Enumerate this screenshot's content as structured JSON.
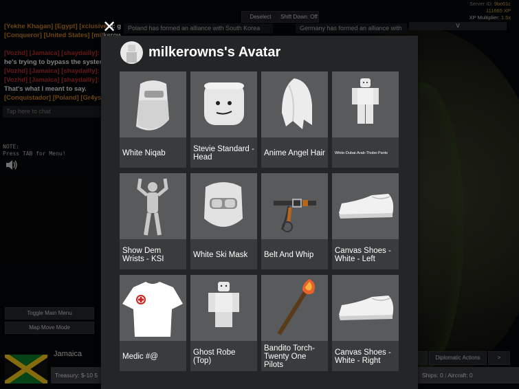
{
  "hud": {
    "deselect": "Deselect",
    "shift_down": "Shift Down: Off",
    "server_label": "Server ID:",
    "server_id": "9bc61c",
    "xp": "111665 XP",
    "xp_mult_label": "XP Multiplier:",
    "xp_mult_value": "1.5x"
  },
  "notifications": [
    "Poland has formed an alliance with South Korea",
    "Germany has formed an alliance with"
  ],
  "search_text": "V",
  "chat": {
    "lines": [
      {
        "parts": [
          {
            "text": "[Yekhe Khagan] [Egypt] [xclusive",
            "color": "org"
          },
          {
            "text": "k]:  grow",
            "color": "txt"
          }
        ]
      },
      {
        "parts": [
          {
            "text": "[Conqueror] [United States] [mil",
            "color": "org"
          },
          {
            "text": "kerowns]:",
            "color": "txt"
          }
        ]
      },
      {
        "parts": [
          {
            "text": "",
            "color": "txt"
          }
        ]
      },
      {
        "parts": [
          {
            "text": "[Vozhd] [Jamaica] [shaydailly]:",
            "color": "red"
          }
        ]
      },
      {
        "parts": [
          {
            "text": "he's trying to bypass the system",
            "color": "txt"
          }
        ]
      },
      {
        "parts": [
          {
            "text": "[Vozhd] [Jamaica] [shaydailly]:",
            "color": "red"
          }
        ]
      },
      {
        "parts": [
          {
            "text": "[Vozhd] [Jamaica] [shaydailly]:",
            "color": "red"
          }
        ]
      },
      {
        "parts": [
          {
            "text": "That's what I meant to say.",
            "color": "txt"
          }
        ]
      },
      {
        "parts": [
          {
            "text": "[Conquistador] [Poland] [Gr4ys",
            "color": "org"
          }
        ]
      }
    ],
    "input_placeholder": "Tap here to chat"
  },
  "note": [
    "NOTE:",
    "Press TAB for Menu!"
  ],
  "left_buttons": [
    "Toggle Main Menu",
    "Map Move Mode"
  ],
  "country": "Jamaica",
  "treasury": "Treasury:  $-10 5",
  "bottom_right": {
    "diplomatic": "Diplomatic Actions",
    "arrow": ">",
    "ships": "Ships: 0",
    "aircraft": "Aircraft: 0"
  },
  "modal": {
    "title": "milkerowns's Avatar",
    "close_glyph": "✕",
    "items": [
      {
        "label": "White Niqab",
        "icon": "niqab-icon"
      },
      {
        "label": "Stevie Standard - Head",
        "icon": "head-icon"
      },
      {
        "label": "Anime Angel Hair",
        "icon": "hair-icon"
      },
      {
        "label": "White-Dubai-Arab-Thobe-Pants",
        "icon": "thobe-icon",
        "small": true
      },
      {
        "label": "Show Dem Wrists - KSI",
        "icon": "figure-icon"
      },
      {
        "label": "White Ski Mask",
        "icon": "ski-mask-icon"
      },
      {
        "label": "Belt And Whip",
        "icon": "belt-whip-icon"
      },
      {
        "label": "Canvas Shoes - White - Left",
        "icon": "shoe-icon"
      },
      {
        "label": "Medic #@",
        "icon": "tshirt-icon"
      },
      {
        "label": "Ghost Robe (Top)",
        "icon": "robe-icon"
      },
      {
        "label": "Bandito Torch- Twenty One Pilots",
        "icon": "torch-icon"
      },
      {
        "label": "Canvas Shoes - White - Right",
        "icon": "shoe-icon"
      }
    ]
  }
}
